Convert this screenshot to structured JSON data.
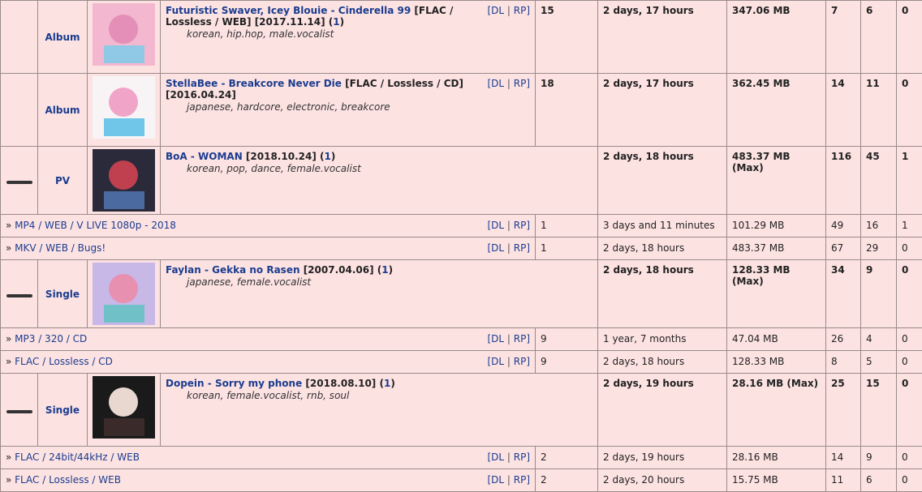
{
  "rows": [
    {
      "type": "group-single",
      "collapse": false,
      "category": "Album",
      "thumb_colors": [
        "#f3b7cf",
        "#e48fb7",
        "#8fc9e6"
      ],
      "artist": "Futuristic Swaver, Icey Blouie",
      "title": "Cinderella 99",
      "suffix": "[FLAC / Lossless / WEB] [2017.11.14] (",
      "count": "1",
      "close": ")",
      "tags": "korean, hip.hop, male.vocalist",
      "dl": "DL",
      "rp": "RP",
      "files": "15",
      "time": "2 days, 17 hours",
      "size": "347.06 MB",
      "snatches": "7",
      "seeders": "6",
      "leechers": "0"
    },
    {
      "type": "group-single",
      "collapse": false,
      "category": "Album",
      "thumb_colors": [
        "#f8f4f6",
        "#f0a4c8",
        "#6fc6e8"
      ],
      "artist": "StellaBee",
      "title": "Breakcore Never Die",
      "suffix": "[FLAC / Lossless / CD] [2016.04.24]",
      "count": "",
      "close": "",
      "tags": "japanese, hardcore, electronic, breakcore",
      "dl": "DL",
      "rp": "RP",
      "files": "18",
      "time": "2 days, 17 hours",
      "size": "362.45 MB",
      "snatches": "14",
      "seeders": "11",
      "leechers": "0"
    }
  ],
  "groups": [
    {
      "category": "PV",
      "thumb_colors": [
        "#2a2a3a",
        "#c04050",
        "#4a6aa0"
      ],
      "artist": "BoA",
      "title": "WOMAN",
      "suffix": "[2018.10.24] (",
      "count": "1",
      "close": ")",
      "tags": "korean, pop, dance, female.vocalist",
      "time": "2 days, 18 hours",
      "size": "483.37 MB (Max)",
      "snatches": "116",
      "seeders": "45",
      "leechers": "1",
      "editions": [
        {
          "label": "MP4 / WEB / V LIVE 1080p - 2018",
          "files": "1",
          "time": "3 days and 11 minutes",
          "size": "101.29 MB",
          "snatches": "49",
          "seeders": "16",
          "leechers": "1"
        },
        {
          "label": "MKV / WEB / Bugs!",
          "files": "1",
          "time": "2 days, 18 hours",
          "size": "483.37 MB",
          "snatches": "67",
          "seeders": "29",
          "leechers": "0"
        }
      ]
    },
    {
      "category": "Single",
      "thumb_colors": [
        "#c8b8e8",
        "#e890b0",
        "#70c0c8"
      ],
      "artist": "Faylan",
      "title": "Gekka no Rasen",
      "suffix": "[2007.04.06] (",
      "count": "1",
      "close": ")",
      "tags": "japanese, female.vocalist",
      "time": "2 days, 18 hours",
      "size": "128.33 MB (Max)",
      "snatches": "34",
      "seeders": "9",
      "leechers": "0",
      "editions": [
        {
          "label": "MP3 / 320 / CD",
          "files": "9",
          "time": "1 year, 7 months",
          "size": "47.04 MB",
          "snatches": "26",
          "seeders": "4",
          "leechers": "0"
        },
        {
          "label": "FLAC / Lossless / CD",
          "files": "9",
          "time": "2 days, 18 hours",
          "size": "128.33 MB",
          "snatches": "8",
          "seeders": "5",
          "leechers": "0"
        }
      ]
    },
    {
      "category": "Single",
      "thumb_colors": [
        "#1a1a1a",
        "#e8d8d0",
        "#3a2a2a"
      ],
      "artist": "Dopein",
      "title": "Sorry my phone",
      "suffix": "[2018.08.10] (",
      "count": "1",
      "close": ")",
      "tags": "korean, female.vocalist, rnb, soul",
      "time": "2 days, 19 hours",
      "size": "28.16 MB (Max)",
      "snatches": "25",
      "seeders": "15",
      "leechers": "0",
      "editions": [
        {
          "label": "FLAC / 24bit/44kHz / WEB",
          "files": "2",
          "time": "2 days, 19 hours",
          "size": "28.16 MB",
          "snatches": "14",
          "seeders": "9",
          "leechers": "0"
        },
        {
          "label": "FLAC / Lossless / WEB",
          "files": "2",
          "time": "2 days, 20 hours",
          "size": "15.75 MB",
          "snatches": "11",
          "seeders": "6",
          "leechers": "0"
        }
      ]
    }
  ],
  "labels": {
    "dl": "DL",
    "rp": "RP",
    "sep": "|",
    "arrow": "»",
    "dash": " - "
  }
}
